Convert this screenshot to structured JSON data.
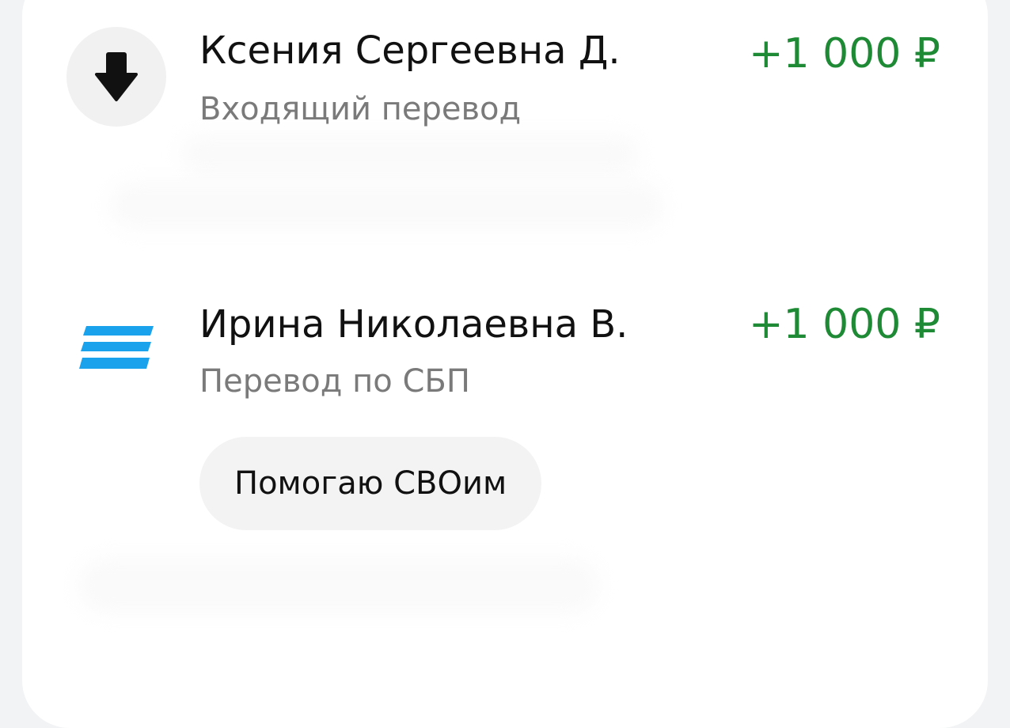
{
  "transactions": [
    {
      "counterparty": "Ксения Сергеевна Д.",
      "type": "Входящий перевод",
      "amount": "+1 000 ₽",
      "icon": "arrow-down-icon"
    },
    {
      "counterparty": "Ирина Николаевна В.",
      "type": "Перевод по СБП",
      "amount": "+1 000 ₽",
      "icon": "sbp-icon",
      "comment": "Помогаю СВОим"
    }
  ],
  "colors": {
    "amount_positive": "#1e8a35",
    "sbp_blue": "#1aa3ec",
    "subtitle": "#7a7a7a"
  }
}
